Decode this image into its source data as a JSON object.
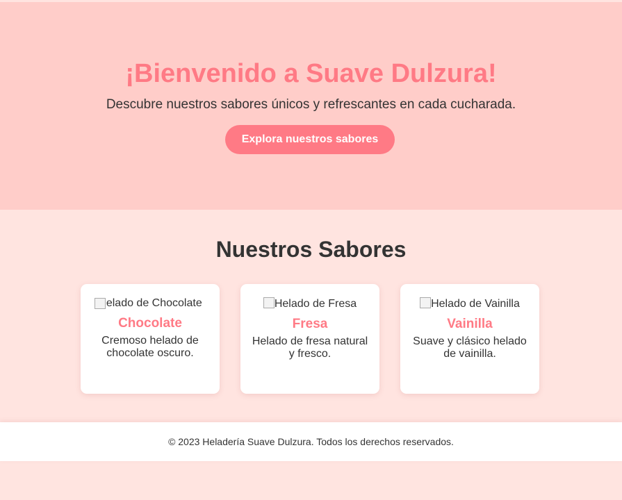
{
  "hero": {
    "title": "¡Bienvenido a Suave Dulzura!",
    "subtitle": "Descubre nuestros sabores únicos y refrescantes en cada cucharada.",
    "button_label": "Explora nuestros sabores"
  },
  "flavors": {
    "title": "Nuestros Sabores",
    "items": [
      {
        "image_alt": "Helado de Chocolate",
        "name": "Chocolate",
        "description": "Cremoso helado de chocolate oscuro."
      },
      {
        "image_alt": "Helado de Fresa",
        "name": "Fresa",
        "description": "Helado de fresa natural y fresco."
      },
      {
        "image_alt": "Helado de Vainilla",
        "name": "Vainilla",
        "description": "Suave y clásico helado de vainilla."
      }
    ]
  },
  "footer": {
    "text": "© 2023 Heladería Suave Dulzura. Todos los derechos reservados."
  },
  "colors": {
    "accent": "#ff7a85",
    "hero_background": "#ffcdc9",
    "page_background": "#ffe4e0",
    "text": "#333333"
  }
}
